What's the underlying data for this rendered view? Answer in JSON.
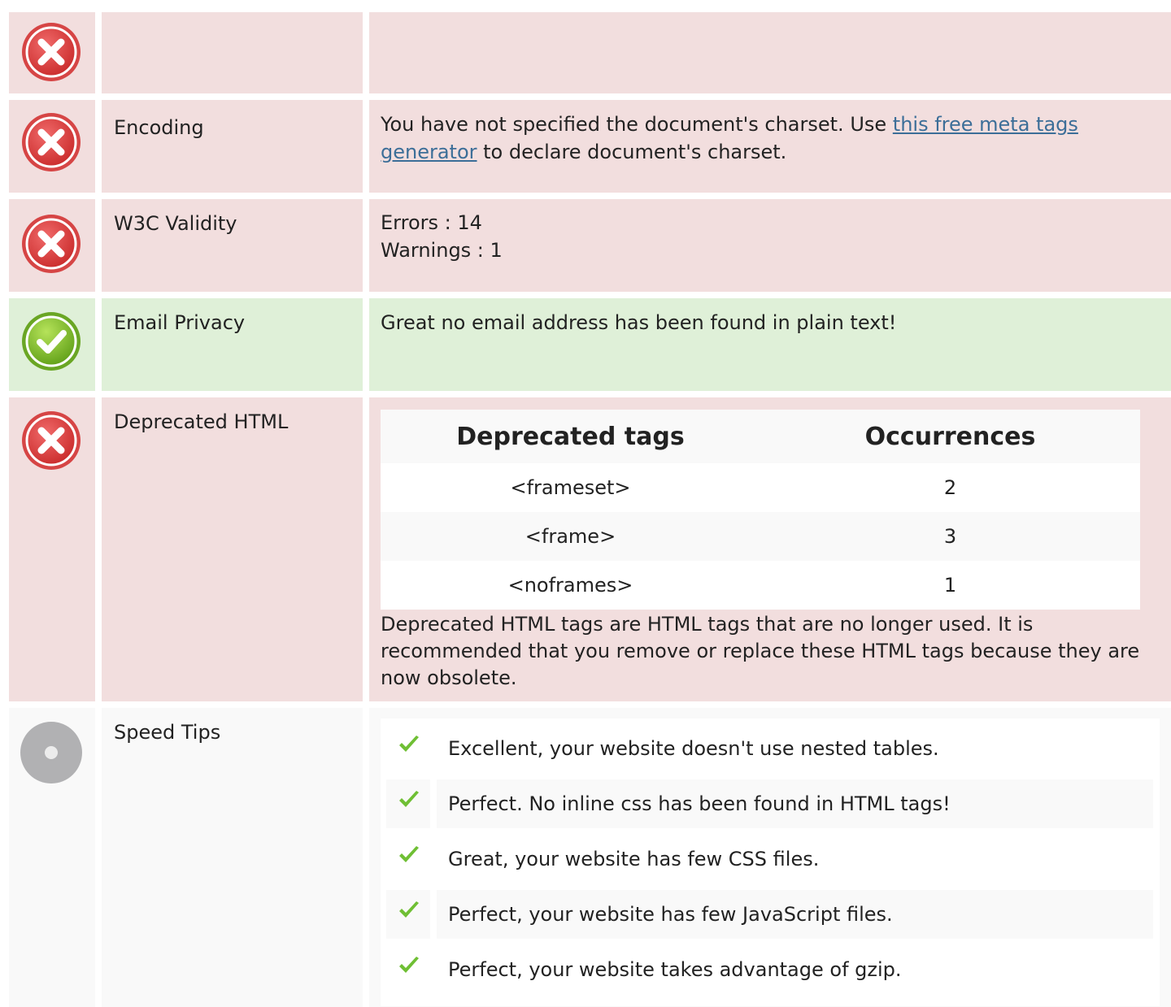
{
  "rows": {
    "top": {
      "status": "error",
      "label": "",
      "description": ""
    },
    "encoding": {
      "status": "error",
      "label": "Encoding",
      "text_before": "You have not specified the document's charset. Use ",
      "link_text": "this free meta tags generator",
      "text_after": " to declare document's charset."
    },
    "w3c": {
      "status": "error",
      "label": "W3C Validity",
      "errors_line": "Errors : 14",
      "warnings_line": "Warnings : 1"
    },
    "email": {
      "status": "success",
      "label": "Email Privacy",
      "description": "Great no email address has been found in plain text!"
    },
    "deprecated": {
      "status": "error",
      "label": "Deprecated HTML",
      "table_headers": [
        "Deprecated tags",
        "Occurrences"
      ],
      "table_rows": [
        {
          "tag": "<frameset>",
          "count": "2"
        },
        {
          "tag": "<frame>",
          "count": "3"
        },
        {
          "tag": "<noframes>",
          "count": "1"
        }
      ],
      "note": "Deprecated HTML tags are HTML tags that are no longer used. It is recommended that you remove or replace these HTML tags because they are now obsolete."
    },
    "speed": {
      "status": "neutral",
      "label": "Speed Tips",
      "tips": [
        "Excellent, your website doesn't use nested tables.",
        "Perfect. No inline css has been found in HTML tags!",
        "Great, your website has few CSS files.",
        "Perfect, your website has few JavaScript files.",
        "Perfect, your website takes advantage of gzip."
      ]
    }
  },
  "icons": {
    "error": "error-x-icon",
    "success": "success-check-icon",
    "neutral": "neutral-circle-icon",
    "tip": "green-checkmark-icon"
  },
  "colors": {
    "error_bg": "#f2dede",
    "success_bg": "#dff0d8",
    "neutral_bg": "#f9f9f9",
    "link": "#3c6e98",
    "check_green": "#6fbf34"
  }
}
